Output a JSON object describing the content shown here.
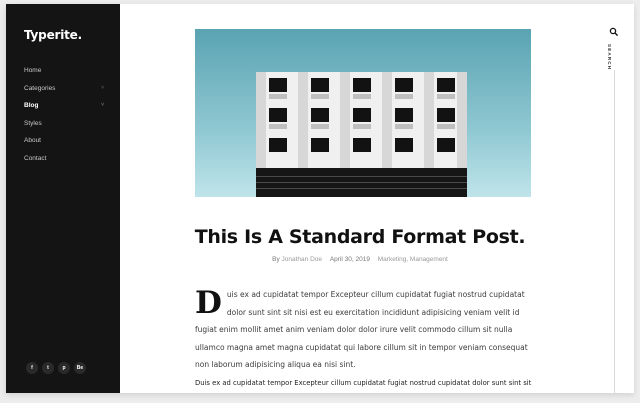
{
  "site": {
    "logo": "Typerite."
  },
  "nav": [
    {
      "label": "Home",
      "chevron": ""
    },
    {
      "label": "Categories",
      "chevron": "˅"
    },
    {
      "label": "Blog",
      "chevron": "˅"
    },
    {
      "label": "Styles",
      "chevron": ""
    },
    {
      "label": "About",
      "chevron": ""
    },
    {
      "label": "Contact",
      "chevron": ""
    }
  ],
  "social": [
    {
      "icon": "facebook-icon",
      "glyph": "f"
    },
    {
      "icon": "twitter-icon",
      "glyph": "t"
    },
    {
      "icon": "pinterest-icon",
      "glyph": "p"
    },
    {
      "icon": "behance-icon",
      "glyph": "Be"
    }
  ],
  "search": {
    "label": "SEARCH"
  },
  "post": {
    "title": "This Is A Standard Format Post.",
    "meta": {
      "by": "By",
      "author": "Jonathan Doe",
      "date": "April 30, 2019",
      "categories": "Marketing, Management"
    },
    "dropcap": "D",
    "paragraph1": "uis ex ad cupidatat tempor Excepteur cillum cupidatat fugiat nostrud cupidatat dolor sunt sint sit nisi est eu exercitation incididunt adipisicing veniam velit id fugiat enim mollit amet anim veniam dolor dolor irure velit commodo cillum sit nulla ullamco magna amet magna cupidatat qui labore cillum sit in tempor veniam consequat non laborum adipisicing aliqua ea nisi sint.",
    "paragraph2": "Duis ex ad cupidatat tempor Excepteur cillum cupidatat fugiat nostrud cupidatat dolor sunt sint sit"
  },
  "colors": {
    "sidebar": "#141414",
    "sky": "#8fc8d2",
    "accent_text": "#9a9a9a"
  }
}
